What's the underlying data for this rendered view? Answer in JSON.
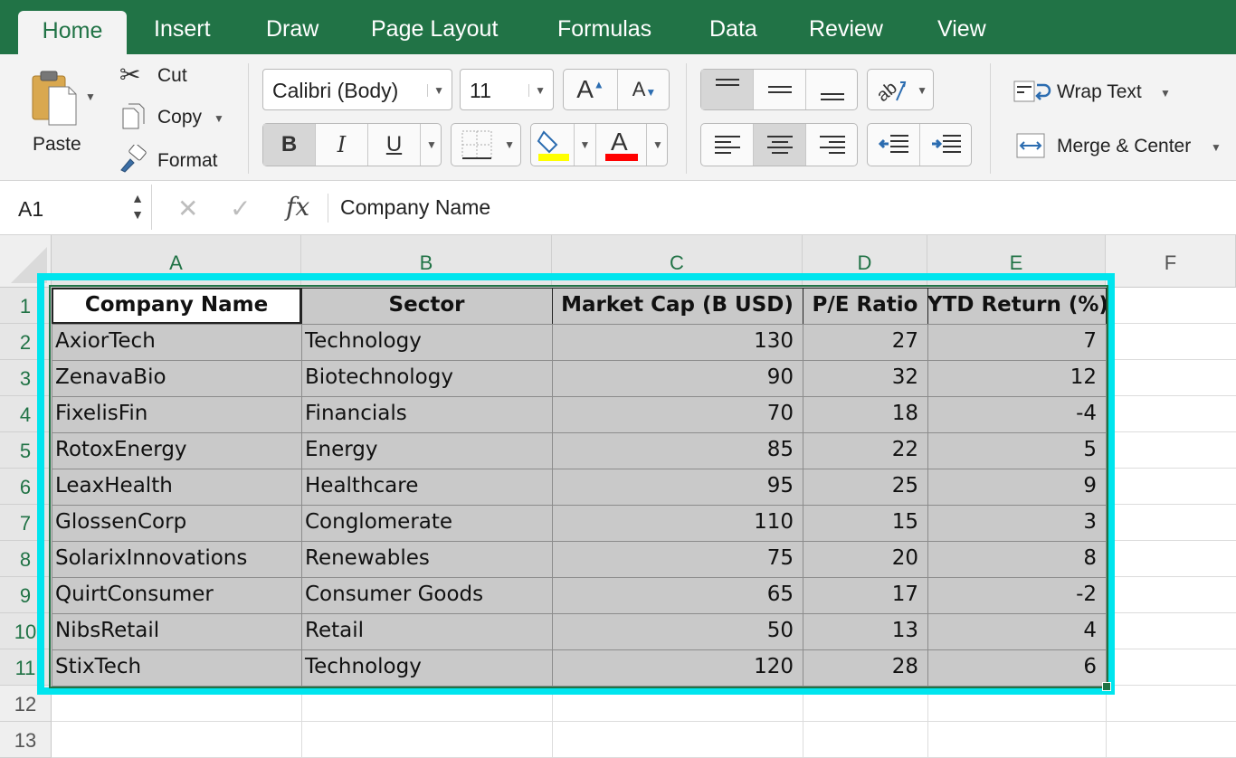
{
  "tabs": {
    "home": "Home",
    "insert": "Insert",
    "draw": "Draw",
    "page_layout": "Page Layout",
    "formulas": "Formulas",
    "data": "Data",
    "review": "Review",
    "view": "View"
  },
  "clipboard": {
    "paste": "Paste",
    "cut": "Cut",
    "copy": "Copy",
    "format": "Format"
  },
  "font": {
    "name": "Calibri (Body)",
    "size": "11",
    "fill_color": "#ffff00",
    "text_color": "#ff0000"
  },
  "alignment": {
    "wrap_text": "Wrap Text",
    "merge_center": "Merge & Center"
  },
  "formula_bar": {
    "name_box": "A1",
    "content": "Company Name"
  },
  "columns": [
    "A",
    "B",
    "C",
    "D",
    "E",
    "F"
  ],
  "rows": [
    "1",
    "2",
    "3",
    "4",
    "5",
    "6",
    "7",
    "8",
    "9",
    "10",
    "11",
    "12",
    "13"
  ],
  "table": {
    "headers": [
      "Company Name",
      "Sector",
      "Market Cap (B USD)",
      "P/E Ratio",
      "YTD Return (%)"
    ],
    "rows": [
      [
        "AxiorTech",
        "Technology",
        "130",
        "27",
        "7"
      ],
      [
        "ZenavaBio",
        "Biotechnology",
        "90",
        "32",
        "12"
      ],
      [
        "FixelisFin",
        "Financials",
        "70",
        "18",
        "-4"
      ],
      [
        "RotoxEnergy",
        "Energy",
        "85",
        "22",
        "5"
      ],
      [
        "LeaxHealth",
        "Healthcare",
        "95",
        "25",
        "9"
      ],
      [
        "GlossenCorp",
        "Conglomerate",
        "110",
        "15",
        "3"
      ],
      [
        "SolarixInnovations",
        "Renewables",
        "75",
        "20",
        "8"
      ],
      [
        "QuirtConsumer",
        "Consumer Goods",
        "65",
        "17",
        "-2"
      ],
      [
        "NibsRetail",
        "Retail",
        "50",
        "13",
        "4"
      ],
      [
        "StixTech",
        "Technology",
        "120",
        "28",
        "6"
      ]
    ]
  },
  "colors": {
    "accent": "#217346",
    "selection_frame": "#00e5ee",
    "cell_shade": "#c9c9c9"
  }
}
